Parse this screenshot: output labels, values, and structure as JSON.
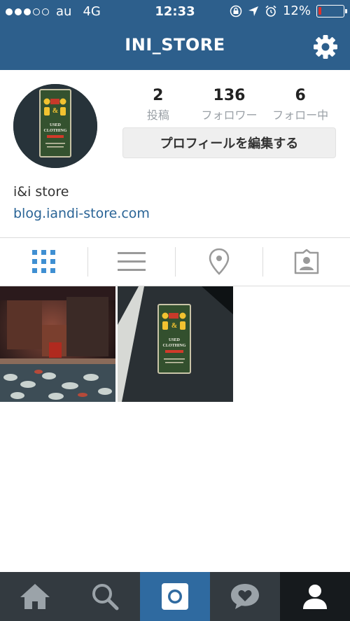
{
  "status_bar": {
    "carrier": "au",
    "network": "4G",
    "time": "12:33",
    "battery_percent_text": "12%",
    "battery_level": 0.12,
    "signal_bars": 3,
    "signal_total": 5
  },
  "header": {
    "title": "INI_STORE",
    "settings_icon": "gear-icon"
  },
  "profile": {
    "avatar_sign_text": [
      "USED",
      "CLOTHING"
    ],
    "stats": [
      {
        "value": "2",
        "label": "投稿"
      },
      {
        "value": "136",
        "label": "フォロワー"
      },
      {
        "value": "6",
        "label": "フォロー中"
      }
    ],
    "edit_button_label": "プロフィールを編集する",
    "display_name": "i&i store",
    "website": "blog.iandi-store.com"
  },
  "tabs": [
    {
      "icon": "grid-icon",
      "active": true
    },
    {
      "icon": "list-icon",
      "active": false
    },
    {
      "icon": "location-pin-icon",
      "active": false
    },
    {
      "icon": "tagged-photos-icon",
      "active": false
    }
  ],
  "posts": [
    {
      "description_icon": "store-interior-photo"
    },
    {
      "description_icon": "store-sign-photo"
    }
  ],
  "bottom_nav": [
    {
      "icon": "home-icon",
      "active": false
    },
    {
      "icon": "search-icon",
      "active": false
    },
    {
      "icon": "camera-icon",
      "active": true
    },
    {
      "icon": "activity-heart-icon",
      "active": false
    },
    {
      "icon": "profile-icon",
      "active": false
    }
  ],
  "colors": {
    "brand_blue": "#2d5f8c",
    "link_blue": "#2a6496",
    "tab_active": "#3f8fd2",
    "battery_low": "#e0302a"
  }
}
